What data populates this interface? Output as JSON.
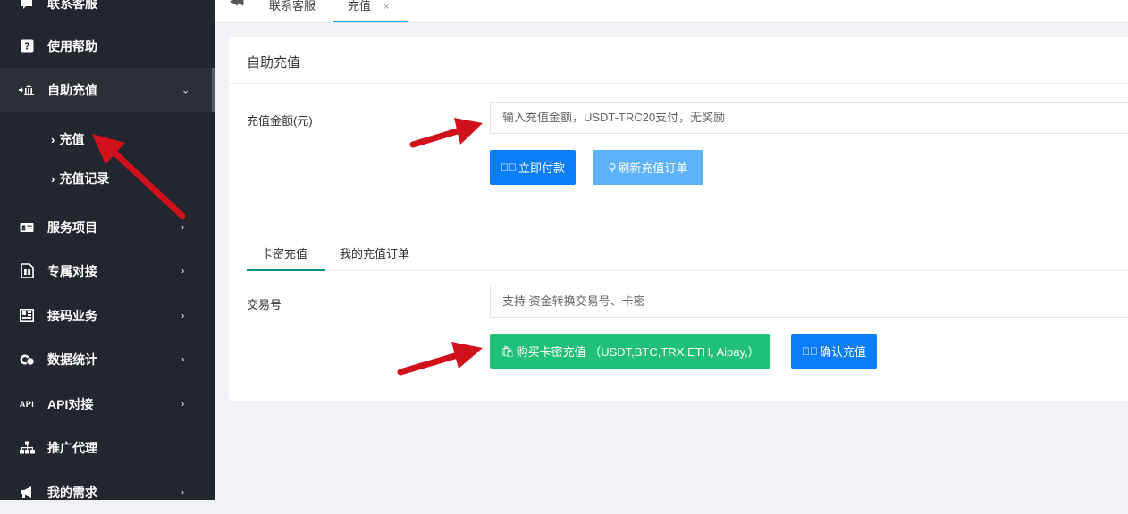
{
  "sidebar": {
    "items": [
      {
        "label": "联系客服",
        "icon": "chat-bubble-icon"
      },
      {
        "label": "使用帮助",
        "icon": "help-icon"
      },
      {
        "label": "自助充值",
        "icon": "bank-icon",
        "expanded": true
      },
      {
        "label": "服务项目",
        "icon": "id-card-icon"
      },
      {
        "label": "专属对接",
        "icon": "sim-card-icon"
      },
      {
        "label": "接码业务",
        "icon": "sms-icon"
      },
      {
        "label": "数据统计",
        "icon": "coins-icon"
      },
      {
        "label": "API对接",
        "icon": "api-icon",
        "icon_text": "API"
      },
      {
        "label": "推广代理",
        "icon": "sitemap-icon"
      },
      {
        "label": "我的需求",
        "icon": "megaphone-icon"
      }
    ],
    "subitems": [
      {
        "label": "充值",
        "active": true
      },
      {
        "label": "充值记录"
      }
    ]
  },
  "topbar": {
    "tabs": [
      {
        "label": "联系客服"
      },
      {
        "label": "充值",
        "close": "×",
        "active": true
      }
    ]
  },
  "card": {
    "title": "自助充值",
    "amount_label": "充值金额(元)",
    "amount_placeholder": "输入充值金额，USDT-TRC20支付，无奖励",
    "pay_button": "立即付款",
    "refresh_button": "刷新充值订单",
    "tabs": [
      {
        "label": "卡密充值",
        "active": true
      },
      {
        "label": "我的充值订单"
      }
    ],
    "tx_label": "交易号",
    "tx_placeholder": "支持 资金转换交易号、卡密",
    "buy_card_button": "购买卡密充值 （USDT,BTC,TRX,ETH, Aipay,）",
    "confirm_button": "确认充值"
  },
  "colors": {
    "sidebar_bg": "#23262e",
    "primary_blue": "#0a7ef8",
    "light_blue": "#5cb3fc",
    "green": "#1fc077",
    "annotation_arrow": "#d0111b"
  }
}
